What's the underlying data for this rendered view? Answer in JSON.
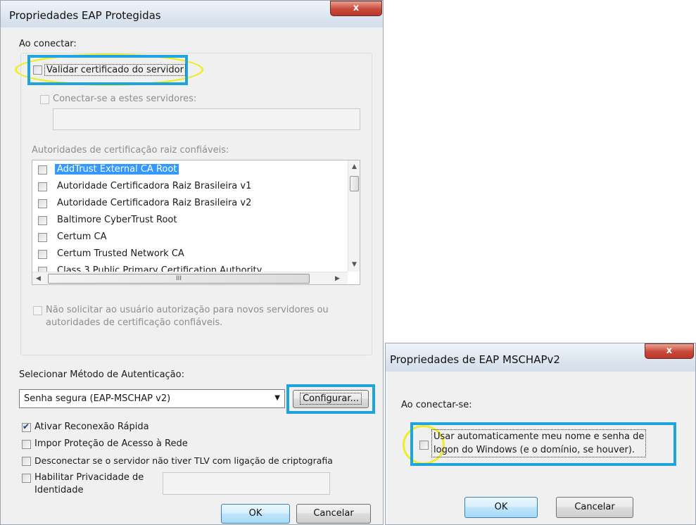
{
  "eap_dialog": {
    "title": "Propriedades EAP Protegidas",
    "close_label": "x",
    "on_connect_label": "Ao conectar:",
    "validate_cert_label": "Validar certificado do servidor",
    "validate_cert_checked": false,
    "connect_servers_label": "Conectar-se a estes servidores:",
    "connect_servers_value": "",
    "trusted_roots_label": "Autoridades de certificação raiz confiáveis:",
    "certificates": [
      {
        "name": "AddTrust External CA Root",
        "selected": true
      },
      {
        "name": "Autoridade Certificadora Raiz Brasileira v1"
      },
      {
        "name": "Autoridade Certificadora Raiz Brasileira v2"
      },
      {
        "name": "Baltimore CyberTrust Root"
      },
      {
        "name": "Certum CA"
      },
      {
        "name": "Certum Trusted Network CA"
      },
      {
        "name": "Class 3 Public Primary Certification Authority"
      }
    ],
    "hscroll_grip": "III",
    "no_prompt_label_line1": "Não solicitar ao usuário autorização para novos servidores ou",
    "no_prompt_label_line2": "autoridades de certificação confiáveis.",
    "auth_method_label": "Selecionar Método de Autenticação:",
    "auth_method_value": "Senha segura (EAP-MSCHAP v2)",
    "configure_label": "Configurar...",
    "fast_reconnect_label": "Ativar Reconexão Rápida",
    "fast_reconnect_checked": true,
    "nap_label": "Impor Proteção de Acesso à Rede",
    "disconnect_label": "Desconectar se o servidor não tiver TLV com ligação de criptografia",
    "privacy_label_line1": "Habilitar Privacidade de",
    "privacy_label_line2": "Identidade",
    "privacy_value": "",
    "ok_label": "OK",
    "cancel_label": "Cancelar"
  },
  "mschap_dialog": {
    "title": "Propriedades de EAP MSCHAPv2",
    "close_label": "x",
    "on_connect_label": "Ao conectar-se:",
    "auto_logon_line1": "Usar automaticamente meu nome e senha de",
    "auto_logon_line2": "logon do Windows (e o domínio, se houver).",
    "auto_logon_checked": false,
    "ok_label": "OK",
    "cancel_label": "Cancelar"
  },
  "colors": {
    "selection": "#3399ff",
    "highlight_blue": "#1ea4de",
    "highlight_yellow": "#f1ec2a",
    "close_red": "#c8483a"
  }
}
